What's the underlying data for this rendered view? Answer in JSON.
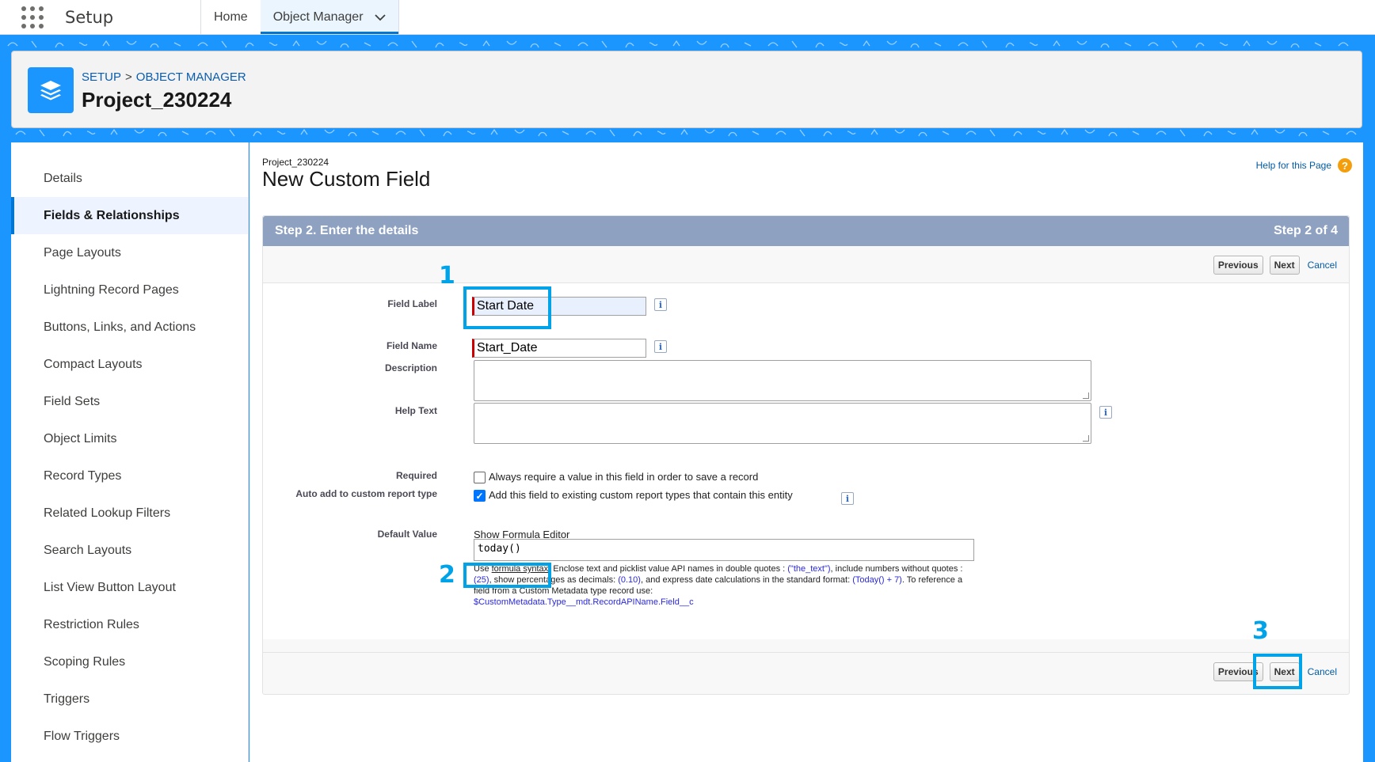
{
  "topnav": {
    "app_name": "Setup",
    "tabs": [
      {
        "label": "Home"
      },
      {
        "label": "Object Manager"
      }
    ]
  },
  "header": {
    "breadcrumb_setup": "SETUP",
    "breadcrumb_sep": ">",
    "breadcrumb_object_manager": "OBJECT MANAGER",
    "title": "Project_230224"
  },
  "sidebar": {
    "items": [
      {
        "label": "Details"
      },
      {
        "label": "Fields & Relationships"
      },
      {
        "label": "Page Layouts"
      },
      {
        "label": "Lightning Record Pages"
      },
      {
        "label": "Buttons, Links, and Actions"
      },
      {
        "label": "Compact Layouts"
      },
      {
        "label": "Field Sets"
      },
      {
        "label": "Object Limits"
      },
      {
        "label": "Record Types"
      },
      {
        "label": "Related Lookup Filters"
      },
      {
        "label": "Search Layouts"
      },
      {
        "label": "List View Button Layout"
      },
      {
        "label": "Restriction Rules"
      },
      {
        "label": "Scoping Rules"
      },
      {
        "label": "Triggers"
      },
      {
        "label": "Flow Triggers"
      }
    ],
    "active_index": 1
  },
  "main": {
    "object_name": "Project_230224",
    "page_title": "New Custom Field",
    "help_link": "Help for this Page",
    "step_title": "Step 2. Enter the details",
    "step_count": "Step 2 of 4",
    "buttons": {
      "previous": "Previous",
      "next": "Next",
      "cancel": "Cancel"
    },
    "form": {
      "field_label_label": "Field Label",
      "field_label_value": "Start Date",
      "field_name_label": "Field Name",
      "field_name_value": "Start_Date",
      "description_label": "Description",
      "help_text_label": "Help Text",
      "required_label": "Required",
      "required_text": "Always require a value in this field in order to save a record",
      "auto_add_label": "Auto add to custom report type",
      "auto_add_text": "Add this field to existing custom report types that contain this entity",
      "default_value_label": "Default Value",
      "show_formula_editor": "Show Formula Editor",
      "formula_value": "today()",
      "hint": {
        "use": "Use",
        "formula_syntax": "formula syntax:",
        "part1": "Enclose text and picklist value API names in double quotes :",
        "ex1": "(\"the_text\")",
        "part2": ", include numbers without quotes :",
        "ex2": "(25)",
        "part3": ", show percentages as decimals:",
        "ex3": "(0.10)",
        "part4": ", and express date calculations in the standard format:",
        "ex4": "(Today() + 7)",
        "part5": ". To reference a field from a Custom Metadata type record use:",
        "ex5": "$CustomMetadata.Type__mdt.RecordAPIName.Field__c"
      }
    }
  },
  "annotations": [
    "1",
    "2",
    "3"
  ],
  "colors": {
    "brand_blue": "#1b96ff",
    "step_header": "#8ea1c1",
    "annotation": "#00a3e8",
    "required_marker": "#cc0000"
  }
}
